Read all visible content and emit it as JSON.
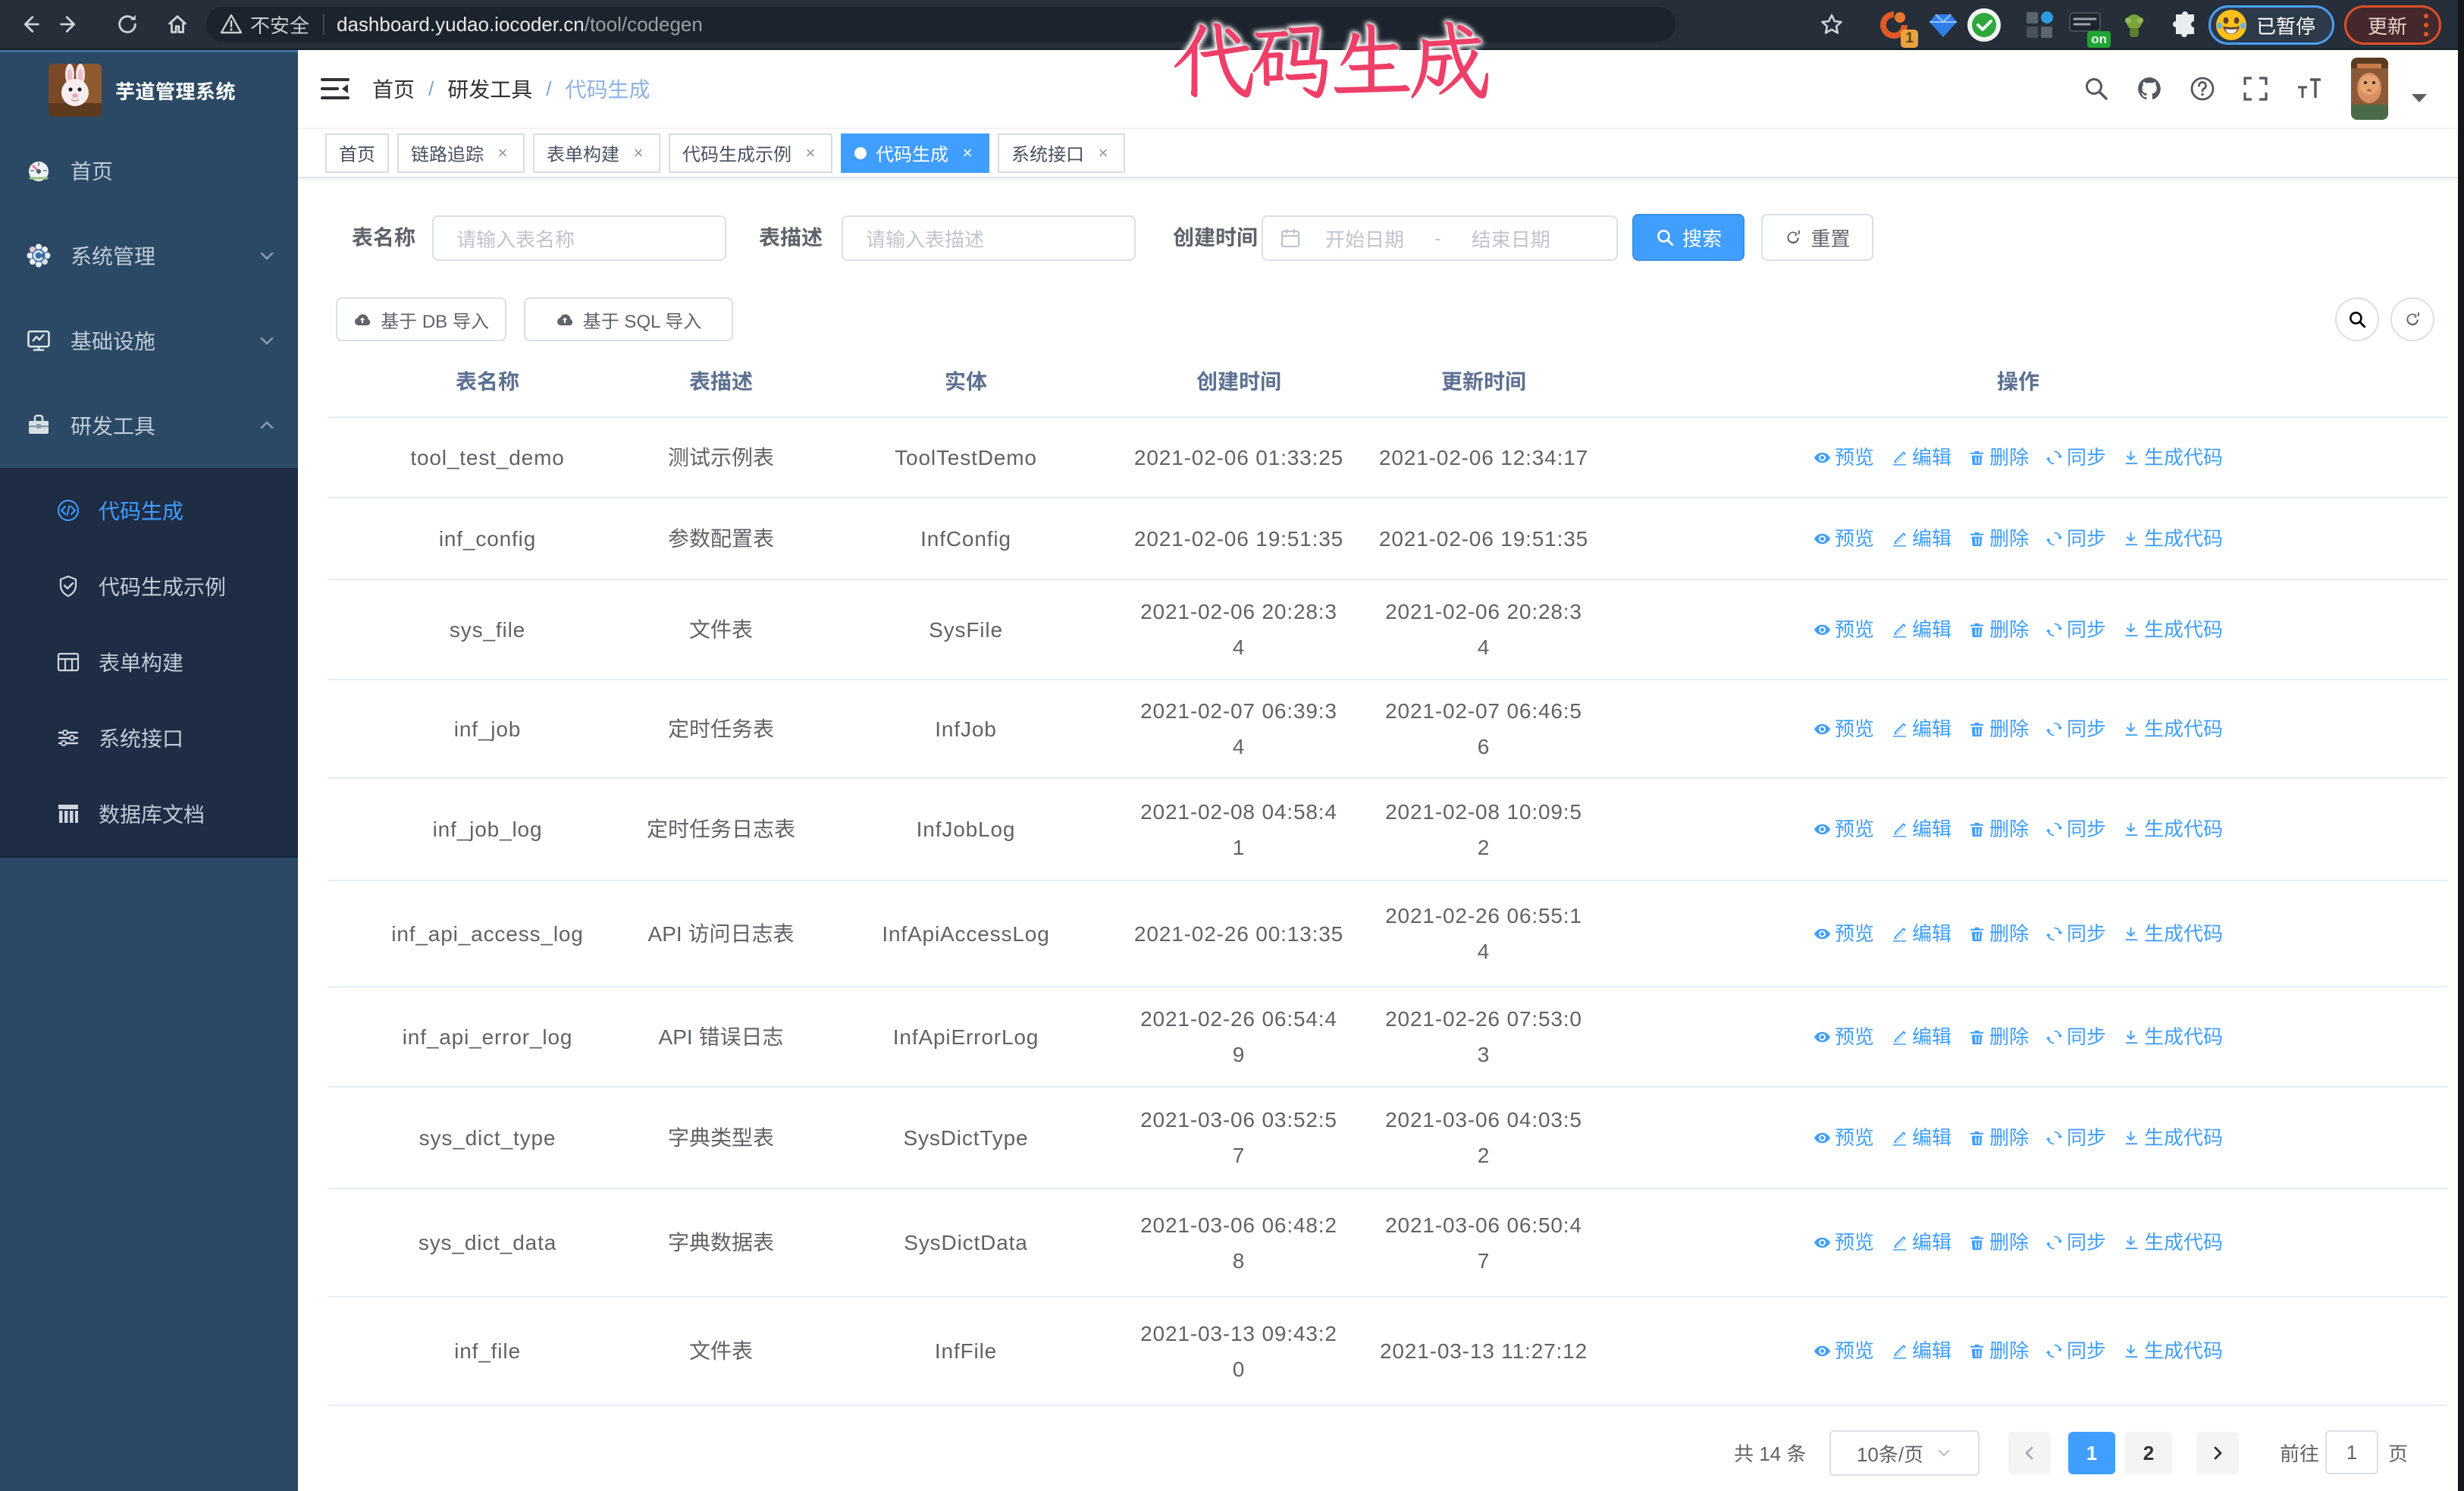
{
  "browser": {
    "security_label": "不安全",
    "url_host": "dashboard.yudao.iocoder.cn",
    "url_path": "/tool/codegen",
    "extension_badge": "1",
    "extension_on": "on",
    "paused_badge": "已暂停",
    "paused_emoji": "😂",
    "update_button": "更新"
  },
  "annotation": {
    "text": "代码生成"
  },
  "sidebar": {
    "title": "芋道管理系统",
    "menu": [
      {
        "label": "首页"
      },
      {
        "label": "系统管理"
      },
      {
        "label": "基础设施"
      },
      {
        "label": "研发工具"
      }
    ],
    "submenu": [
      {
        "label": "代码生成",
        "active": true
      },
      {
        "label": "代码生成示例"
      },
      {
        "label": "表单构建"
      },
      {
        "label": "系统接口"
      },
      {
        "label": "数据库文档"
      }
    ]
  },
  "navbar": {
    "breadcrumb": [
      "首页",
      "研发工具",
      "代码生成"
    ],
    "separator": "/"
  },
  "tags": [
    {
      "label": "首页"
    },
    {
      "label": "链路追踪"
    },
    {
      "label": "表单构建"
    },
    {
      "label": "代码生成示例"
    },
    {
      "label": "代码生成"
    },
    {
      "label": "系统接口"
    }
  ],
  "filter": {
    "table_name_label": "表名称",
    "table_name_placeholder": "请输入表名称",
    "table_desc_label": "表描述",
    "table_desc_placeholder": "请输入表描述",
    "create_time_label": "创建时间",
    "date_start_placeholder": "开始日期",
    "date_separator": "-",
    "date_end_placeholder": "结束日期",
    "search_button": "搜索",
    "reset_button": "重置"
  },
  "toolbar": {
    "import_db_button": "基于 DB 导入",
    "import_sql_button": "基于 SQL 导入"
  },
  "table": {
    "columns": [
      "表名称",
      "表描述",
      "实体",
      "创建时间",
      "更新时间",
      "操作"
    ],
    "action_labels": [
      "预览",
      "编辑",
      "删除",
      "同步",
      "生成代码"
    ],
    "rows": [
      {
        "name": "tool_test_demo",
        "desc": "测试示例表",
        "entity": "ToolTestDemo",
        "created": "2021-02-06 01:33:25",
        "updated": "2021-02-06 12:34:17"
      },
      {
        "name": "inf_config",
        "desc": "参数配置表",
        "entity": "InfConfig",
        "created": "2021-02-06 19:51:35",
        "updated": "2021-02-06 19:51:35"
      },
      {
        "name": "sys_file",
        "desc": "文件表",
        "entity": "SysFile",
        "created": [
          "2021-02-06 20:28:3",
          "4"
        ],
        "updated": [
          "2021-02-06 20:28:3",
          "4"
        ]
      },
      {
        "name": "inf_job",
        "desc": "定时任务表",
        "entity": "InfJob",
        "created": [
          "2021-02-07 06:39:3",
          "4"
        ],
        "updated": [
          "2021-02-07 06:46:5",
          "6"
        ]
      },
      {
        "name": "inf_job_log",
        "desc": "定时任务日志表",
        "entity": "InfJobLog",
        "created": [
          "2021-02-08 04:58:4",
          "1"
        ],
        "updated": [
          "2021-02-08 10:09:5",
          "2"
        ]
      },
      {
        "name": "inf_api_access_log",
        "desc": "API 访问日志表",
        "entity": "InfApiAccessLog",
        "created": "2021-02-26 00:13:35",
        "updated": [
          "2021-02-26 06:55:1",
          "4"
        ]
      },
      {
        "name": "inf_api_error_log",
        "desc": "API 错误日志",
        "entity": "InfApiErrorLog",
        "created": [
          "2021-02-26 06:54:4",
          "9"
        ],
        "updated": [
          "2021-02-26 07:53:0",
          "3"
        ]
      },
      {
        "name": "sys_dict_type",
        "desc": "字典类型表",
        "entity": "SysDictType",
        "created": [
          "2021-03-06 03:52:5",
          "7"
        ],
        "updated": [
          "2021-03-06 04:03:5",
          "2"
        ]
      },
      {
        "name": "sys_dict_data",
        "desc": "字典数据表",
        "entity": "SysDictData",
        "created": [
          "2021-03-06 06:48:2",
          "8"
        ],
        "updated": [
          "2021-03-06 06:50:4",
          "7"
        ]
      },
      {
        "name": "inf_file",
        "desc": "文件表",
        "entity": "InfFile",
        "created": [
          "2021-03-13 09:43:2",
          "0"
        ],
        "updated": "2021-03-13 11:27:12"
      }
    ]
  },
  "pagination": {
    "total_label": "共 14 条",
    "page_size": "10条/页",
    "pages": [
      "1",
      "2"
    ],
    "active_page": "1",
    "goto_label": "前往",
    "goto_value": "1",
    "page_suffix": "页"
  },
  "colors": {
    "accent": "#409eff",
    "annotation": "#ee3f68",
    "sidebar_bg": "#2b4964",
    "submenu_bg": "#1e2c44"
  }
}
